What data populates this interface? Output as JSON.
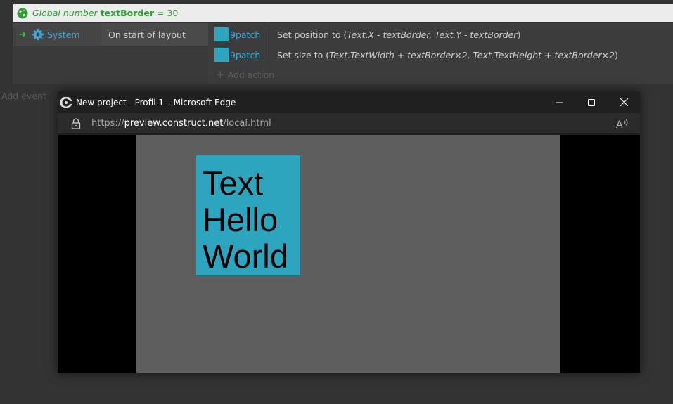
{
  "global_variable": {
    "keyword": "Global number",
    "name": "textBorder",
    "equals": "= 30"
  },
  "event": {
    "condition": {
      "object": "System",
      "text": "On start of layout"
    },
    "actions": [
      {
        "object": "9patch",
        "text_prefix": "Set position to (",
        "params": "Text.X - textBorder, Text.Y - textBorder",
        "text_suffix": ")"
      },
      {
        "object": "9patch",
        "text_prefix": "Set size to (",
        "params": "Text.TextWidth + textBorder×2, Text.TextHeight + textBorder×2",
        "text_suffix": ")"
      }
    ],
    "add_action_label": "Add action"
  },
  "add_event_label": "Add event",
  "browser": {
    "title": "New project - Profil 1 – Microsoft Edge",
    "url_scheme": "https://",
    "url_host": "preview.construct.net",
    "url_path": "/local.html",
    "preview_text": "Text Hello World"
  },
  "colors": {
    "accent_green": "#2e9e35",
    "object_blue": "#3fa9d9",
    "patch_color": "#2ea5be",
    "layout_bg": "#5e5e5e"
  },
  "icons": {
    "global": "globe-icon",
    "system": "gear-icon",
    "object": "9patch-object-icon",
    "lock": "lock-icon",
    "read_aloud": "read-aloud-icon"
  }
}
